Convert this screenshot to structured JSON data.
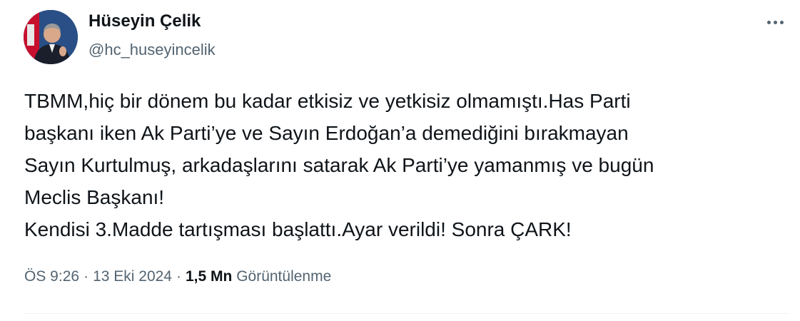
{
  "author": {
    "name": "Hüseyin Çelik",
    "handle": "@hc_huseyincelik"
  },
  "tweet": {
    "lines": [
      "TBMM,hiç bir dönem bu kadar etkisiz ve yetkisiz olmamıştı.Has Parti",
      "başkanı iken Ak Parti’ye ve Sayın Erdoğan’a demediğini bırakmayan",
      "Sayın Kurtulmuş, arkadaşlarını satarak Ak Parti’ye yamanmış ve bugün",
      "Meclis Başkanı!",
      "Kendisi 3.Madde tartışması başlattı.Ayar verildi! Sonra ÇARK!"
    ]
  },
  "meta": {
    "time": "ÖS 9:26",
    "separator": "·",
    "date": "13 Eki 2024",
    "views_count": "1,5 Mn",
    "views_label": "Görüntülenme"
  },
  "icons": {
    "more": "more-horizontal-icon"
  },
  "colors": {
    "text_primary": "#0f1419",
    "text_secondary": "#536471",
    "divider": "#eff3f4"
  }
}
